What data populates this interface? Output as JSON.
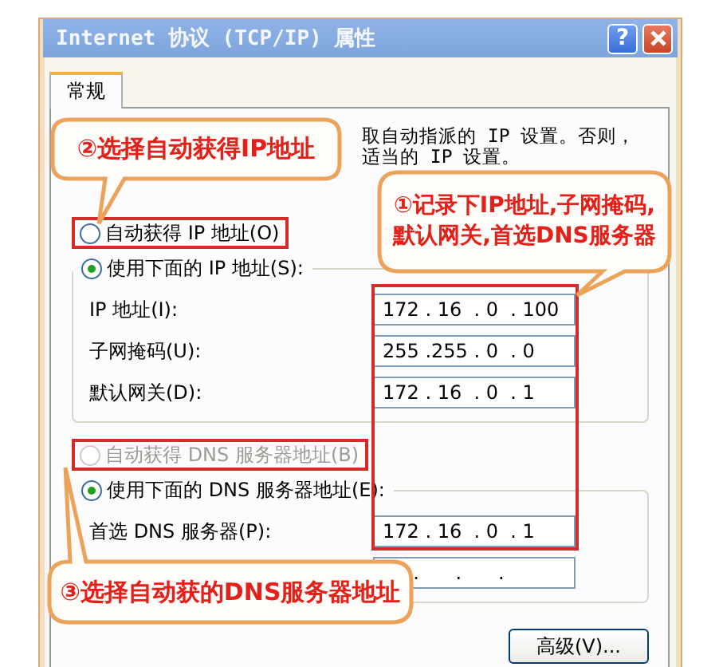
{
  "window": {
    "title": "Internet 协议 (TCP/IP) 属性",
    "help_button": "?"
  },
  "tabs": [
    {
      "label": "常规",
      "selected": true
    }
  ],
  "intro_lines": [
    "取自动指派的 IP 设置。否则，",
    "适当的 IP 设置。"
  ],
  "ip_options": [
    {
      "label": "自动获得 IP 地址(O)",
      "selected": false,
      "disabled": false,
      "highlighted": true
    },
    {
      "label": "使用下面的 IP 地址(S):",
      "selected": true,
      "disabled": false,
      "highlighted": false
    }
  ],
  "ip_fields": [
    {
      "label": "IP 地址(I):",
      "value": "172 . 16  . 0  . 100"
    },
    {
      "label": "子网掩码(U):",
      "value": "255 .255 . 0  . 0"
    },
    {
      "label": "默认网关(D):",
      "value": "172 . 16  . 0  . 1"
    }
  ],
  "dns_options": [
    {
      "label": "自动获得 DNS 服务器地址(B)",
      "selected": false,
      "disabled": true,
      "highlighted": true
    },
    {
      "label": "使用下面的 DNS 服务器地址(E):",
      "selected": true,
      "disabled": false,
      "highlighted": false
    }
  ],
  "dns_fields": [
    {
      "label": "首选 DNS 服务器(P):",
      "value": "172 . 16  . 0  . 1"
    },
    {
      "value": "     .      .      ."
    }
  ],
  "fields_highlighted": true,
  "advanced_button": "高级(V)...",
  "callouts": [
    {
      "lines": [
        "②选择自动获得IP地址"
      ]
    },
    {
      "lines": [
        "①记录下IP地址,子网掩码,",
        "默认网关,首选DNS服务器"
      ]
    },
    {
      "lines": [
        "③选择自动获的DNS服务器地址"
      ]
    }
  ]
}
